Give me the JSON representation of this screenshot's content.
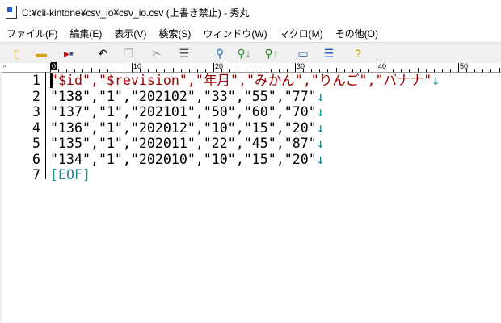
{
  "window": {
    "title": "C:¥cli-kintone¥csv_io¥csv_io.csv (上書き禁止) - 秀丸"
  },
  "menu": [
    "ファイル(F)",
    "編集(E)",
    "表示(V)",
    "検索(S)",
    "ウィンドウ(W)",
    "マクロ(M)",
    "その他(O)"
  ],
  "toolbar": [
    "new-file-icon",
    "open-folder-icon",
    "save-icon",
    "undo-icon",
    "copy-icon",
    "cut-icon",
    "paste-icon",
    "search-icon",
    "search-next-icon",
    "search-prev-icon",
    "grep-icon",
    "split-window-icon",
    "help-icon"
  ],
  "ruler": {
    "marker": "»",
    "labels": [
      "0",
      "10",
      "20",
      "30",
      "40",
      "50"
    ]
  },
  "editor": {
    "lines": [
      {
        "n": "1",
        "text": "\"$id\",\"$revision\",\"年月\",\"みかん\",\"りんご\",\"バナナ\"",
        "eol": "↓"
      },
      {
        "n": "2",
        "text": "\"138\",\"1\",\"202102\",\"33\",\"55\",\"77\"",
        "eol": "↓"
      },
      {
        "n": "3",
        "text": "\"137\",\"1\",\"202101\",\"50\",\"60\",\"70\"",
        "eol": "↓"
      },
      {
        "n": "4",
        "text": "\"136\",\"1\",\"202012\",\"10\",\"15\",\"20\"",
        "eol": "↓"
      },
      {
        "n": "5",
        "text": "\"135\",\"1\",\"202011\",\"22\",\"45\",\"87\"",
        "eol": "↓"
      },
      {
        "n": "6",
        "text": "\"134\",\"1\",\"202010\",\"10\",\"15\",\"20\"",
        "eol": "↓"
      },
      {
        "n": "7",
        "text": "[EOF]",
        "eol": ""
      }
    ]
  },
  "colors": {
    "header_line": "#a00000",
    "eol": "#1a9090"
  }
}
